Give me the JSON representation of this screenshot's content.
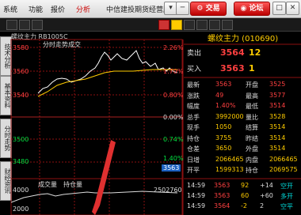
{
  "menu": {
    "items": [
      "系统",
      "功能",
      "报价",
      "分析",
      "中信建投期货经营版"
    ],
    "highlighted": "分析",
    "window_buttons": [
      "▾",
      "─",
      "□",
      "✕"
    ],
    "trade_button": "交易",
    "forum_button": "论坛"
  },
  "toolbar": {
    "icons": [
      "back-icon",
      "forward-icon",
      "chart-icon",
      "pen-icon",
      "grid-icon",
      "list-icon",
      "line-icon",
      "ruler-icon",
      "menu-icon"
    ]
  },
  "side_tabs": [
    "技术分析",
    "基本资料",
    "分时走势",
    "财经资讯"
  ],
  "stock_header": "螺纹主力 RB1005C",
  "chart": {
    "title_left": "分时走势",
    "title_mid": "成交",
    "price_labels": [
      "3580",
      "3560",
      "3540",
      "3500",
      "3480"
    ],
    "pct_labels": [
      "2.26%",
      "1.70%",
      "0.80%",
      "0.00%",
      "0.74%",
      "1.40%"
    ],
    "current_value": "3563",
    "volume_title": "成交量",
    "volume_sub": "持仓量",
    "volume_axis": [
      "4000",
      "2000"
    ],
    "volume_right": "2502760"
  },
  "quote": {
    "title": "螺纹主力 (010690)",
    "sell": {
      "label": "卖出",
      "price": "3564",
      "qty": "12"
    },
    "buy": {
      "label": "买入",
      "price": "3563",
      "qty": "1"
    },
    "details": [
      {
        "l1": "最新",
        "v1": "3563",
        "l2": "开盘",
        "v2": "3525"
      },
      {
        "l1": "涨跌",
        "v1": "49",
        "l2": "最高",
        "v2": "3577"
      },
      {
        "l1": "幅度",
        "v1": "1.40%",
        "l2": "最低",
        "v2": "3514"
      },
      {
        "l1": "总手",
        "v1": "3992000",
        "l2": "量比",
        "v2": "3528"
      },
      {
        "l1": "现手",
        "v1": "1050",
        "l2": "结算",
        "v2": "3514"
      },
      {
        "l1": "持仓",
        "v1": "3755",
        "l2": "昨结",
        "v2": "3514"
      },
      {
        "l1": "仓差",
        "v1": "3650",
        "l2": "外盘",
        "v2": "3514"
      },
      {
        "l1": "日增",
        "v1": "2066465",
        "l2": "内盘",
        "v2": "2066465"
      },
      {
        "l1": "开平",
        "v1": "1599313",
        "l2": "持仓",
        "v2": "2069575"
      }
    ],
    "ticks": [
      {
        "time": "14:59",
        "price": "3563",
        "vol": "92",
        "type": "+14",
        "flag": "空开"
      },
      {
        "time": "14:59",
        "price": "3563",
        "vol": "60",
        "type": "+60",
        "flag": "多开"
      },
      {
        "time": "14:59",
        "price": "3564",
        "vol": "-2",
        "type": "2",
        "flag": "空平"
      }
    ]
  },
  "colors": {
    "up": "#ff4040",
    "down": "#00e040",
    "price_line": "#ffffff",
    "avg_line": "#ffcc00",
    "arrow": "#e03030"
  }
}
